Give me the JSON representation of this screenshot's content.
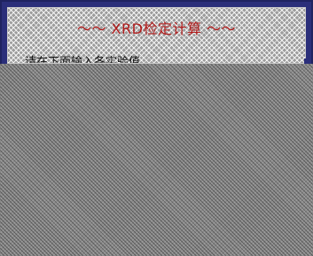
{
  "window": {
    "title": "～～ XRD检定计算 ～～",
    "prompt": "请在下面输入各实验值"
  },
  "colors": {
    "frame": "#2b2f7a",
    "title_text": "#b11b1b",
    "overlay": "#8a8a8a"
  }
}
